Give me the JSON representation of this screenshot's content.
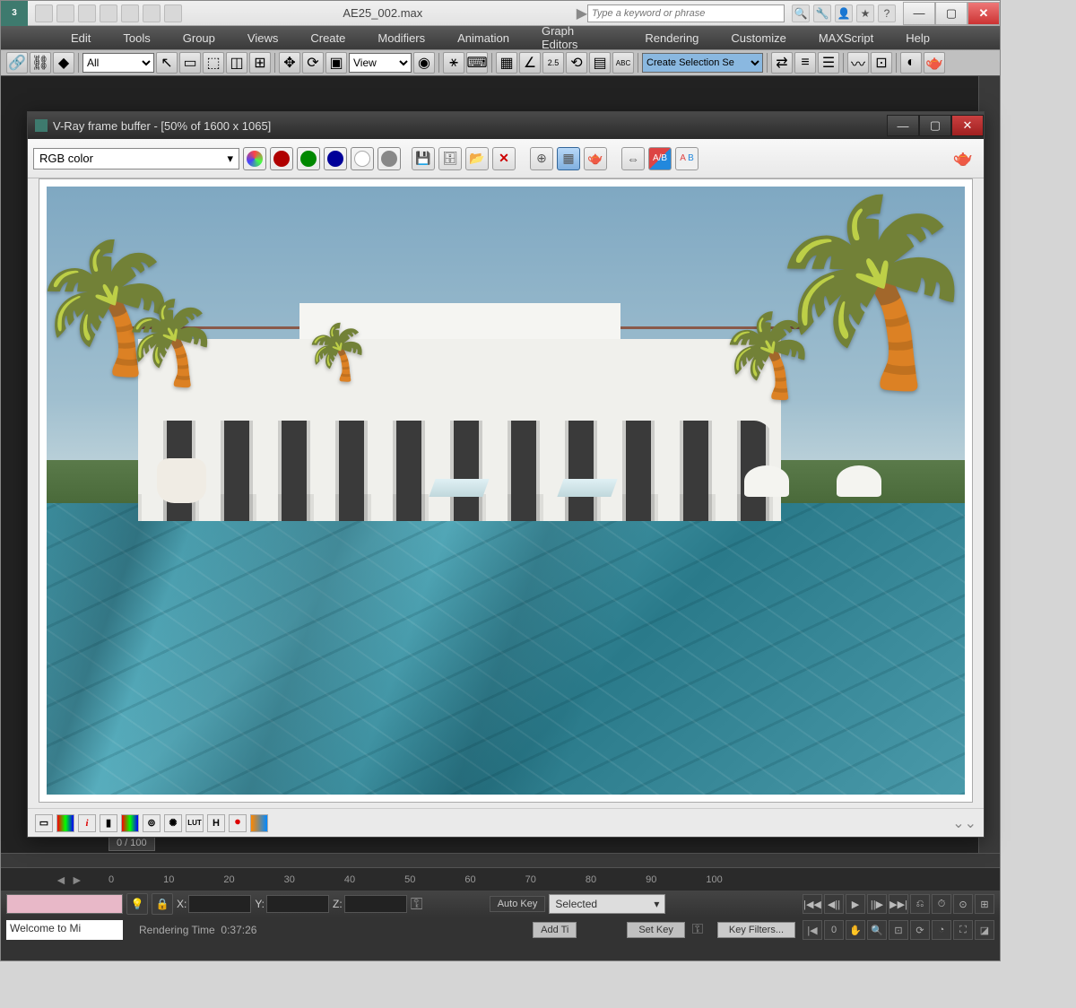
{
  "main": {
    "title": "AE25_002.max",
    "search_placeholder": "Type a keyword or phrase",
    "menus": [
      "Edit",
      "Tools",
      "Group",
      "Views",
      "Create",
      "Modifiers",
      "Animation",
      "Graph Editors",
      "Rendering",
      "Customize",
      "MAXScript",
      "Help"
    ],
    "toolbar": {
      "filter_all": "All",
      "view_select": "View",
      "named_selection": "Create Selection Se"
    }
  },
  "vray": {
    "title": "V-Ray frame buffer - [50% of 1600 x 1065]",
    "channel_select": "RGB color",
    "bottom_icons": {
      "i": "i",
      "lut": "LUT",
      "h": "H"
    }
  },
  "timeline": {
    "frame_badge": "0 / 100",
    "ticks": [
      "0",
      "10",
      "20",
      "30",
      "40",
      "50",
      "60",
      "70",
      "80",
      "90",
      "100"
    ]
  },
  "status": {
    "x_label": "X:",
    "y_label": "Y:",
    "z_label": "Z:",
    "auto_key": "Auto Key",
    "set_key": "Set Key",
    "selected": "Selected",
    "key_filters": "Key Filters...",
    "add_ti": "Add Ti",
    "welcome": "Welcome to Mi",
    "render_time_label": "Rendering Time",
    "render_time_value": "0:37:26"
  }
}
